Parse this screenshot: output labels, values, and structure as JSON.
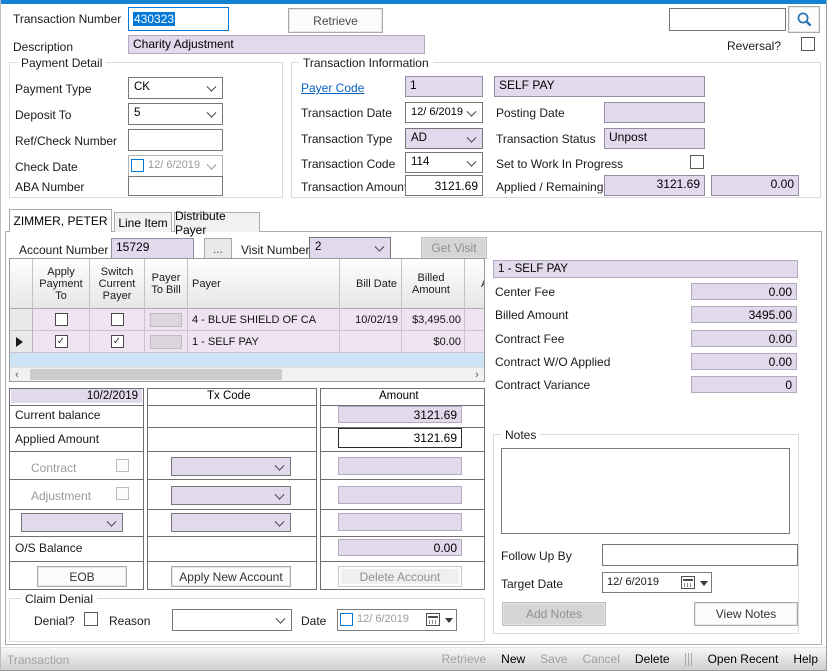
{
  "colors": {
    "accent_blue": "#0078D7",
    "top_strip_blue": "#1583D3",
    "readonly_field_lavender": "#E2D9ED",
    "grid_row_lavender": "#EFE3F1",
    "grid_empty_blue": "#CDE4F7",
    "link_blue": "#0563C1"
  },
  "header": {
    "transaction_number_label": "Transaction Number",
    "transaction_number_value": "430323",
    "retrieve_button": "Retrieve",
    "search_value": "",
    "description_label": "Description",
    "description_value": "Charity Adjustment",
    "reversal_label": "Reversal?"
  },
  "payment_detail": {
    "title": "Payment Detail",
    "payment_type_label": "Payment Type",
    "payment_type_value": "CK",
    "deposit_to_label": "Deposit To",
    "deposit_to_value": "5",
    "ref_check_label": "Ref/Check Number",
    "ref_check_value": "",
    "check_date_label": "Check Date",
    "check_date_value": "12/ 6/2019",
    "aba_label": "ABA Number",
    "aba_value": ""
  },
  "transaction_info": {
    "title": "Transaction Information",
    "payer_code_label": "Payer Code",
    "payer_code_value": "1",
    "payer_name": "SELF PAY",
    "transaction_date_label": "Transaction Date",
    "transaction_date_value": "12/ 6/2019",
    "posting_date_label": "Posting Date",
    "posting_date_value": "",
    "transaction_type_label": "Transaction Type",
    "transaction_type_value": "AD",
    "transaction_status_label": "Transaction Status",
    "transaction_status_value": "Unpost",
    "transaction_code_label": "Transaction Code",
    "transaction_code_value": "114",
    "wip_label": "Set to Work In Progress",
    "transaction_amount_label": "Transaction Amount",
    "transaction_amount_value": "3121.69",
    "applied_remaining_label": "Applied / Remaining",
    "applied_value": "3121.69",
    "remaining_value": "0.00"
  },
  "tabs": {
    "patient": "ZIMMER, PETER",
    "line_item": "Line Item",
    "distribute_payer": "Distribute Payer"
  },
  "visit_bar": {
    "account_number_label": "Account Number",
    "account_number_value": "15729",
    "browse_button": "...",
    "visit_number_label": "Visit Number",
    "visit_number_value": "2",
    "get_visit_button": "Get Visit"
  },
  "payer_grid": {
    "columns": [
      "Apply Payment To",
      "Switch Current Payer",
      "Payer To Bill",
      "Payer",
      "Bill Date",
      "Billed Amount"
    ],
    "partial_column": "A",
    "rows": [
      {
        "apply_check": "",
        "switch_check": "",
        "payer": "4 - BLUE SHIELD OF CA",
        "bill_date": "10/02/19",
        "billed_amount": "$3,495.00"
      },
      {
        "apply_check": "✓",
        "switch_check": "✓",
        "payer": "1 - SELF PAY",
        "bill_date": "",
        "billed_amount": "$0.00"
      }
    ]
  },
  "payer_summary": {
    "header": "1 - SELF PAY",
    "fields": [
      {
        "label": "Center Fee",
        "value": "0.00"
      },
      {
        "label": "Billed Amount",
        "value": "3495.00"
      },
      {
        "label": "Contract Fee",
        "value": "0.00"
      },
      {
        "label": "Contract W/O Applied",
        "value": "0.00"
      },
      {
        "label": "Contract Variance",
        "value": "0"
      }
    ]
  },
  "apply_grid": {
    "date_header": "10/2/2019",
    "tx_code_header": "Tx Code",
    "amount_header": "Amount",
    "current_balance_label": "Current balance",
    "current_balance_value": "3121.69",
    "applied_amount_label": "Applied Amount",
    "applied_amount_value": "3121.69",
    "contract_label": "Contract",
    "adjustment_label": "Adjustment",
    "os_balance_label": "O/S Balance",
    "os_balance_value": "0.00",
    "eob_button": "EOB",
    "apply_new_account_button": "Apply New Account",
    "delete_account_button": "Delete Account"
  },
  "claim_denial": {
    "title": "Claim Denial",
    "denial_label": "Denial?",
    "reason_label": "Reason",
    "date_label": "Date",
    "date_value": "12/ 6/2019"
  },
  "notes": {
    "title": "Notes",
    "note_text": "",
    "follow_up_by_label": "Follow Up By",
    "follow_up_by_value": "",
    "target_date_label": "Target Date",
    "target_date_value": "12/ 6/2019",
    "add_notes_button": "Add Notes",
    "view_notes_button": "View Notes"
  },
  "status_bar": {
    "module_label": "Transaction",
    "items": [
      {
        "label": "Retrieve",
        "enabled": false
      },
      {
        "label": "New",
        "enabled": true
      },
      {
        "label": "Save",
        "enabled": false
      },
      {
        "label": "Cancel",
        "enabled": false
      },
      {
        "label": "Delete",
        "enabled": true
      },
      {
        "label": "Open Recent",
        "enabled": true
      },
      {
        "label": "Help",
        "enabled": true
      }
    ]
  }
}
